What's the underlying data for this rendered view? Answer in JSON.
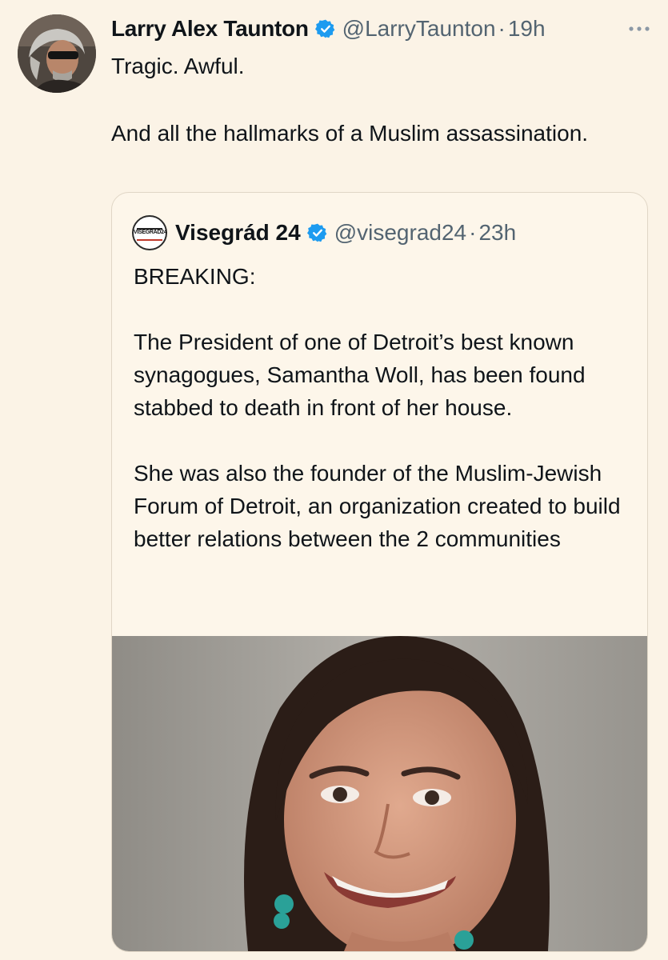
{
  "tweet": {
    "author_name": "Larry Alex Taunton",
    "handle": "@LarryTaunton",
    "separator": "·",
    "time": "19h",
    "paragraphs": [
      "Tragic. Awful.",
      "And all the hallmarks of a Muslim assassination."
    ]
  },
  "quoted": {
    "logo_text": "VISEGRAD24",
    "author_name": "Visegrád 24",
    "handle": "@visegrad24",
    "separator": "·",
    "time": "23h",
    "paragraphs": [
      "BREAKING:",
      "The President of one of Detroit’s best known synagogues, Samantha Woll, has been found stabbed to death in front of her house.",
      "She was also the founder of the Muslim-Jewish Forum of Detroit, an organization created to build better relations between the 2 communities"
    ]
  },
  "icons": {
    "verified": "verified-badge-icon",
    "more": "more-dots-icon"
  },
  "colors": {
    "background": "#fbf3e6",
    "text": "#0f1419",
    "secondary_text": "#536471",
    "verified": "#1d9bf0"
  }
}
